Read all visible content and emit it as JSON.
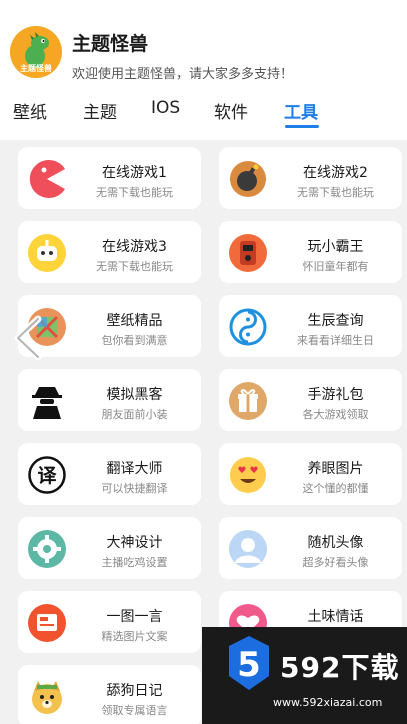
{
  "app": {
    "title": "主题怪兽",
    "subtitle": "欢迎使用主题怪兽，请大家多多支持！",
    "logo_text": "主题怪兽",
    "logo_icon": "green-dinosaur-icon"
  },
  "tabs": [
    {
      "label": "壁纸",
      "active": false
    },
    {
      "label": "主题",
      "active": false
    },
    {
      "label": "IOS",
      "active": false
    },
    {
      "label": "软件",
      "active": false
    },
    {
      "label": "工具",
      "active": true
    }
  ],
  "tools": [
    {
      "title": "在线游戏1",
      "desc": "无需下载也能玩",
      "icon": "pacman-icon"
    },
    {
      "title": "在线游戏2",
      "desc": "无需下载也能玩",
      "icon": "bomb-icon"
    },
    {
      "title": "在线游戏3",
      "desc": "无需下载也能玩",
      "icon": "robot-icon"
    },
    {
      "title": "玩小霸王",
      "desc": "怀旧童年都有",
      "icon": "game-console-icon"
    },
    {
      "title": "壁纸精品",
      "desc": "包你看到满意",
      "icon": "wallpaper-icon"
    },
    {
      "title": "生辰查询",
      "desc": "来看看详细生日",
      "icon": "yin-yang-icon"
    },
    {
      "title": "模拟黑客",
      "desc": "朋友面前小装",
      "icon": "hacker-icon"
    },
    {
      "title": "手游礼包",
      "desc": "各大游戏领取",
      "icon": "gift-icon"
    },
    {
      "title": "翻译大师",
      "desc": "可以快捷翻译",
      "icon": "translate-icon"
    },
    {
      "title": "养眼图片",
      "desc": "这个懂的都懂",
      "icon": "heart-eyes-emoji-icon"
    },
    {
      "title": "大神设计",
      "desc": "主播吃鸡设置",
      "icon": "settings-gear-icon"
    },
    {
      "title": "随机头像",
      "desc": "超多好看头像",
      "icon": "avatar-icon"
    },
    {
      "title": "一图一言",
      "desc": "精选图片文案",
      "icon": "image-quote-icon"
    },
    {
      "title": "土味情话",
      "desc": "",
      "icon": "heart-icon"
    },
    {
      "title": "舔狗日记",
      "desc": "领取专属语言",
      "icon": "dog-icon"
    }
  ],
  "watermark": {
    "brand": "592下载",
    "url": "www.592xiazai.com"
  },
  "colors": {
    "accent": "#1e7ee8",
    "background": "#f1f1f1",
    "card": "#ffffff"
  }
}
